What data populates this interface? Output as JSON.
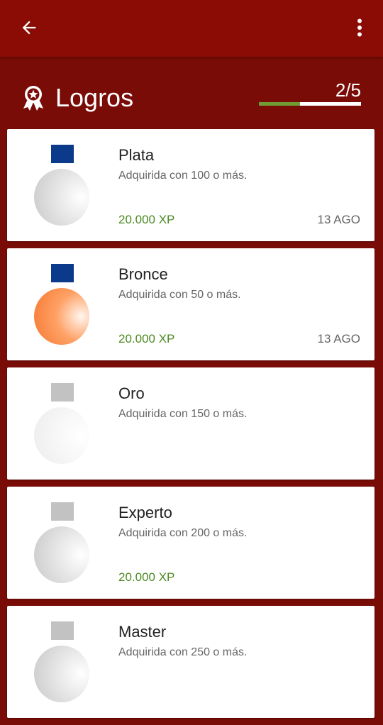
{
  "appbar": {
    "back_icon": "arrow-left-icon",
    "menu_icon": "more-vertical-icon"
  },
  "header": {
    "icon": "award-icon",
    "title": "Logros",
    "count": "2/5",
    "progress": 0.4,
    "progress_color": "#6f9c33"
  },
  "achievements": [
    {
      "name": "Plata",
      "description": "Adquirida con 100 o más.",
      "xp": "20.000 XP",
      "date": "13 AGO",
      "unlocked": true,
      "ribbon_color": "#0b3a8a",
      "medal": "silver"
    },
    {
      "name": "Bronce",
      "description": "Adquirida con 50 o más.",
      "xp": "20.000 XP",
      "date": "13 AGO",
      "unlocked": true,
      "ribbon_color": "#0b3a8a",
      "medal": "bronze"
    },
    {
      "name": "Oro",
      "description": "Adquirida con 150 o más.",
      "xp": "",
      "date": "",
      "unlocked": false,
      "ribbon_color": "#c2c2c2",
      "medal": "faded"
    },
    {
      "name": "Experto",
      "description": "Adquirida con 200 o más.",
      "xp": "20.000 XP",
      "date": "",
      "unlocked": false,
      "ribbon_color": "#c2c2c2",
      "medal": "silver"
    },
    {
      "name": "Master",
      "description": "Adquirida con 250 o más.",
      "xp": "",
      "date": "",
      "unlocked": false,
      "ribbon_color": "#c2c2c2",
      "medal": "silver"
    }
  ]
}
